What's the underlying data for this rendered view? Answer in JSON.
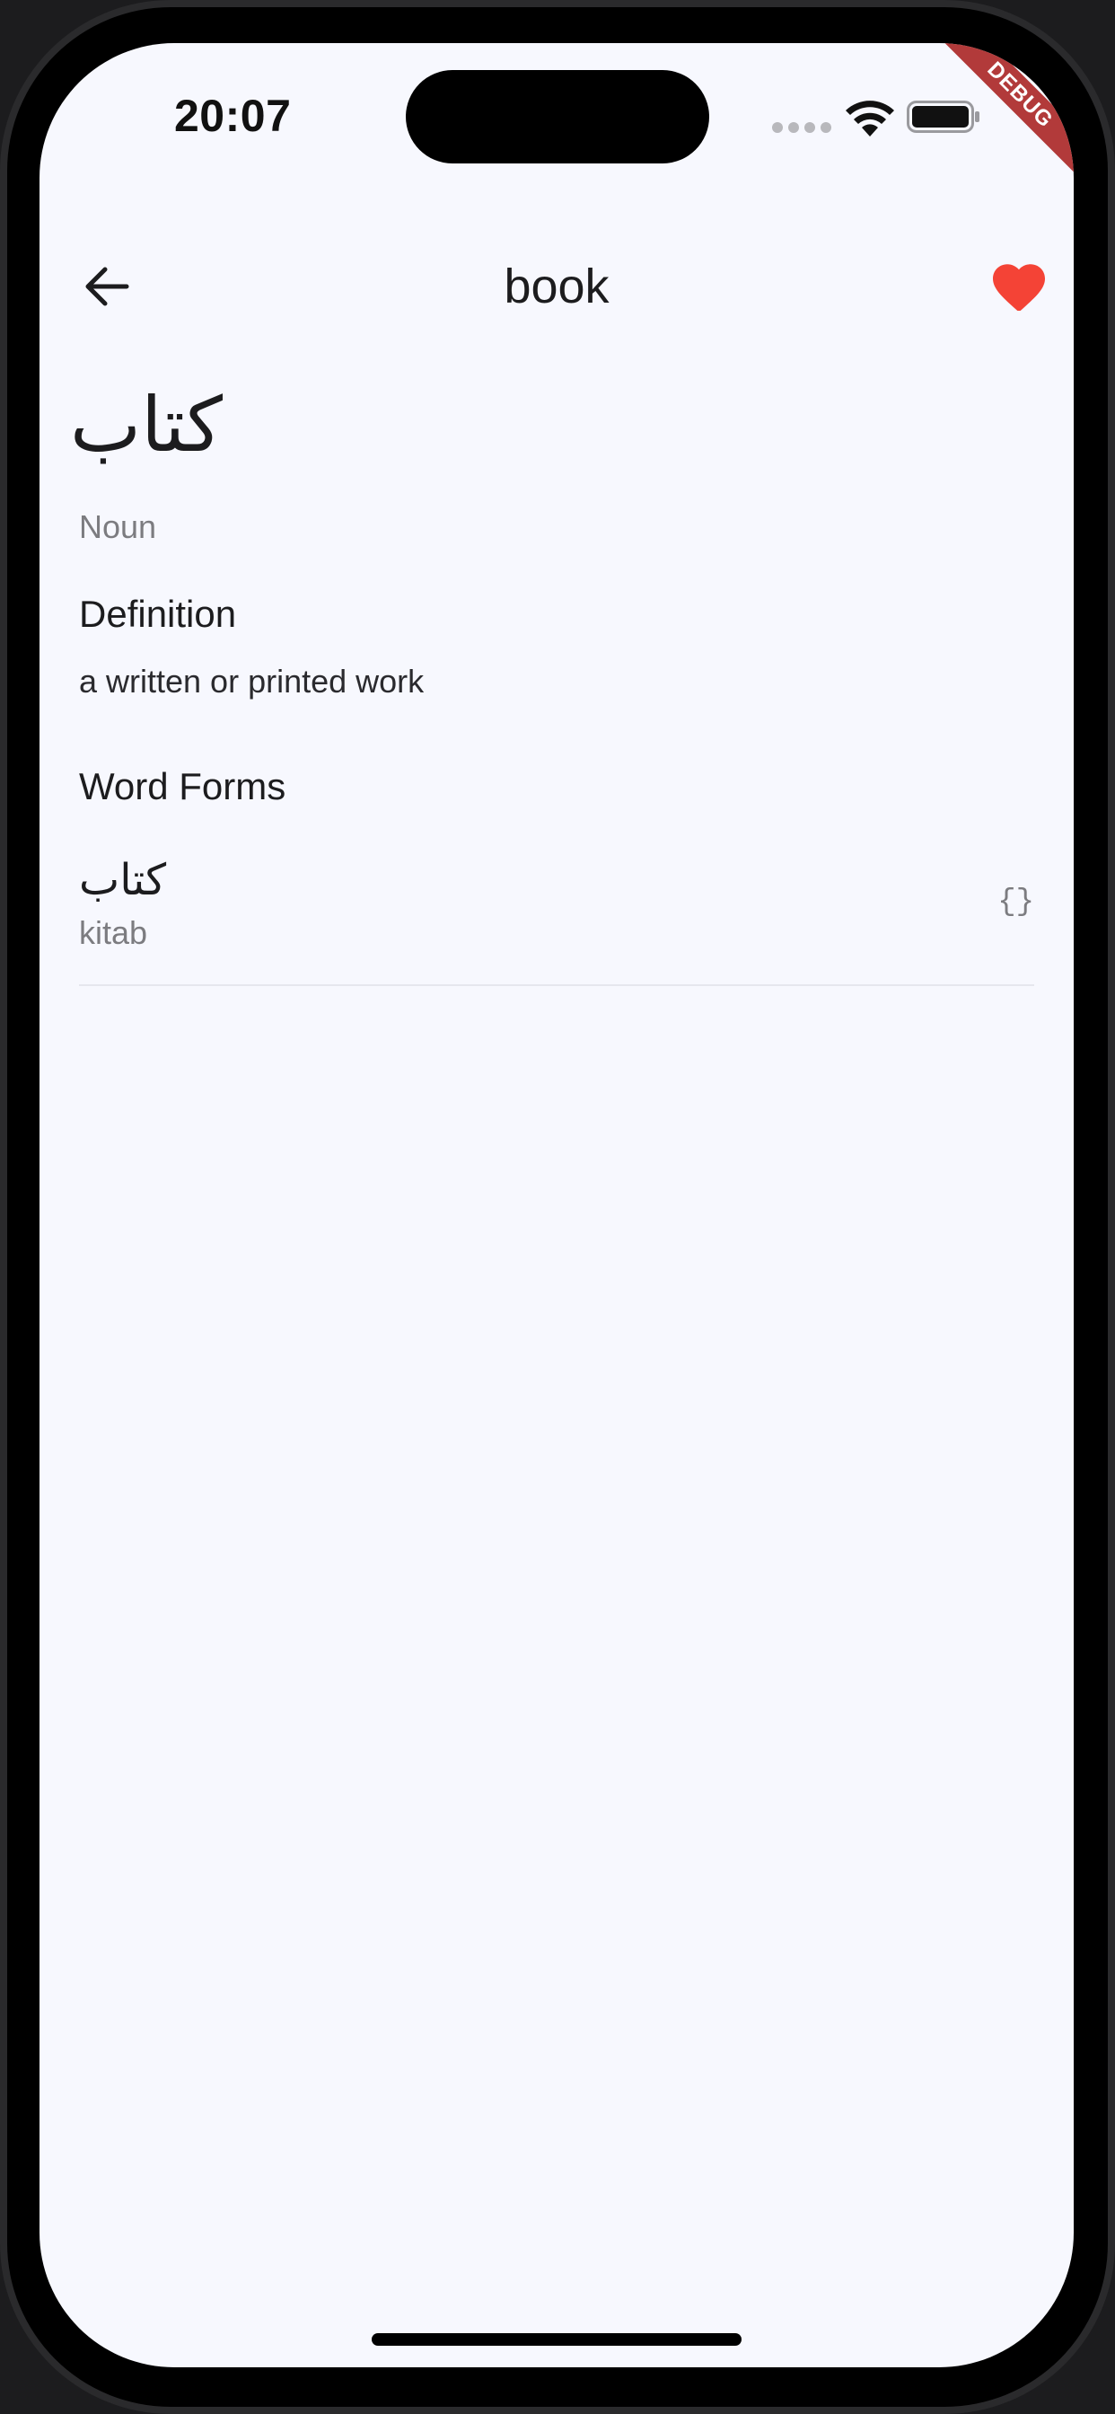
{
  "status_bar": {
    "time": "20:07",
    "icons": [
      "cellular-dots-icon",
      "wifi-icon",
      "battery-icon"
    ]
  },
  "debug_banner": "DEBUG",
  "app_bar": {
    "title": "book",
    "back_icon": "arrow-back-icon",
    "favorite_icon": "heart-icon",
    "favorite_active": true,
    "favorite_color": "#f44336"
  },
  "entry": {
    "arabic": "كتاب",
    "part_of_speech": "Noun",
    "definition_heading": "Definition",
    "definition": "a written or printed work",
    "word_forms_heading": "Word Forms",
    "word_forms": [
      {
        "arabic": "كتاب",
        "transliteration": "kitab",
        "code": "{}"
      }
    ]
  },
  "colors": {
    "background": "#f7f8fe",
    "text_primary": "#1c1c1e",
    "text_secondary": "#7c7c80",
    "accent_favorite": "#f44336",
    "debug_banner": "#b23a3a"
  }
}
